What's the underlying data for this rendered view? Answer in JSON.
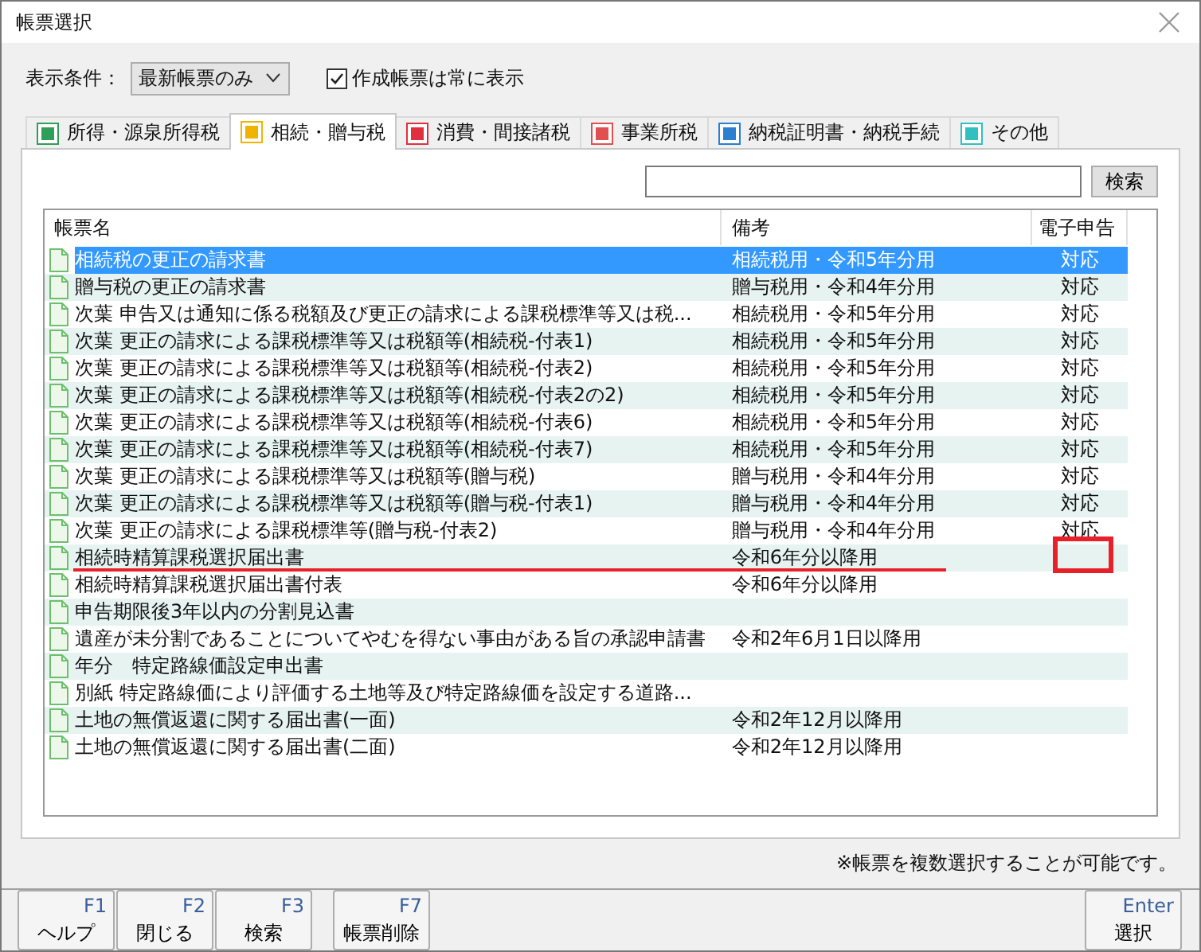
{
  "window": {
    "title": "帳票選択"
  },
  "filter": {
    "label": "表示条件：",
    "dropdown": "最新帳票のみ",
    "checkbox": {
      "label": "作成帳票は常に表示",
      "checked": true
    }
  },
  "tabs": [
    {
      "label": "所得・源泉所得税",
      "selected": false,
      "color": "#2e9e5a"
    },
    {
      "label": "相続・贈与税",
      "selected": true,
      "color": "#f0b400"
    },
    {
      "label": "消費・間接諸税",
      "selected": false,
      "color": "#e03040"
    },
    {
      "label": "事業所税",
      "selected": false,
      "color": "#e05050"
    },
    {
      "label": "納税証明書・納税手続",
      "selected": false,
      "color": "#2a7fd0"
    },
    {
      "label": "その他",
      "selected": false,
      "color": "#30c0c0"
    }
  ],
  "search": {
    "button": "検索"
  },
  "table": {
    "columns": [
      "帳票名",
      "備考",
      "電子申告"
    ],
    "rows": [
      {
        "name": "相続税の更正の請求書",
        "remark": "相続税用・令和5年分用",
        "efile": "対応",
        "selected": true,
        "marked": false
      },
      {
        "name": "贈与税の更正の請求書",
        "remark": "贈与税用・令和4年分用",
        "efile": "対応",
        "selected": false,
        "marked": false
      },
      {
        "name": "次葉 申告又は通知に係る税額及び更正の請求による課税標準等又は税...",
        "remark": "相続税用・令和5年分用",
        "efile": "対応",
        "selected": false,
        "marked": false
      },
      {
        "name": "次葉 更正の請求による課税標準等又は税額等(相続税-付表1)",
        "remark": "相続税用・令和5年分用",
        "efile": "対応",
        "selected": false,
        "marked": false
      },
      {
        "name": "次葉 更正の請求による課税標準等又は税額等(相続税-付表2)",
        "remark": "相続税用・令和5年分用",
        "efile": "対応",
        "selected": false,
        "marked": false
      },
      {
        "name": "次葉 更正の請求による課税標準等又は税額等(相続税-付表2の2)",
        "remark": "相続税用・令和5年分用",
        "efile": "対応",
        "selected": false,
        "marked": false
      },
      {
        "name": "次葉 更正の請求による課税標準等又は税額等(相続税-付表6)",
        "remark": "相続税用・令和5年分用",
        "efile": "対応",
        "selected": false,
        "marked": false
      },
      {
        "name": "次葉 更正の請求による課税標準等又は税額等(相続税-付表7)",
        "remark": "相続税用・令和5年分用",
        "efile": "対応",
        "selected": false,
        "marked": false
      },
      {
        "name": "次葉 更正の請求による課税標準等又は税額等(贈与税)",
        "remark": "贈与税用・令和4年分用",
        "efile": "対応",
        "selected": false,
        "marked": false
      },
      {
        "name": "次葉 更正の請求による課税標準等又は税額等(贈与税-付表1)",
        "remark": "贈与税用・令和4年分用",
        "efile": "対応",
        "selected": false,
        "marked": false
      },
      {
        "name": "次葉 更正の請求による課税標準等(贈与税-付表2)",
        "remark": "贈与税用・令和4年分用",
        "efile": "対応",
        "selected": false,
        "marked": false
      },
      {
        "name": "相続時精算課税選択届出書",
        "remark": "令和6年分以降用",
        "selected": false,
        "marked": true
      },
      {
        "name": "相続時精算課税選択届出書付表",
        "remark": "令和6年分以降用",
        "selected": false,
        "marked": false
      },
      {
        "name": "申告期限後3年以内の分割見込書",
        "selected": false,
        "marked": false
      },
      {
        "name": "遺産が未分割であることについてやむを得ない事由がある旨の承認申請書",
        "remark": "令和2年6月1日以降用",
        "selected": false,
        "marked": false
      },
      {
        "name": "年分　特定路線価設定申出書",
        "selected": false,
        "marked": false
      },
      {
        "name": "別紙 特定路線価により評価する土地等及び特定路線価を設定する道路...",
        "selected": false,
        "marked": false
      },
      {
        "name": "土地の無償返還に関する届出書(一面)",
        "remark": "令和2年12月以降用",
        "selected": false,
        "marked": false
      },
      {
        "name": "土地の無償返還に関する届出書(二面)",
        "remark": "令和2年12月以降用",
        "selected": false,
        "marked": false
      }
    ]
  },
  "note": "※帳票を複数選択することが可能です。",
  "key_groups": [
    [
      {
        "key": "F1",
        "label": "ヘルプ"
      },
      {
        "key": "F2",
        "label": "閉じる"
      },
      {
        "key": "F3",
        "label": "検索"
      }
    ],
    [
      {
        "key": "F7",
        "label": "帳票削除"
      }
    ]
  ],
  "enter_key": {
    "key": "Enter",
    "label": "選択"
  }
}
